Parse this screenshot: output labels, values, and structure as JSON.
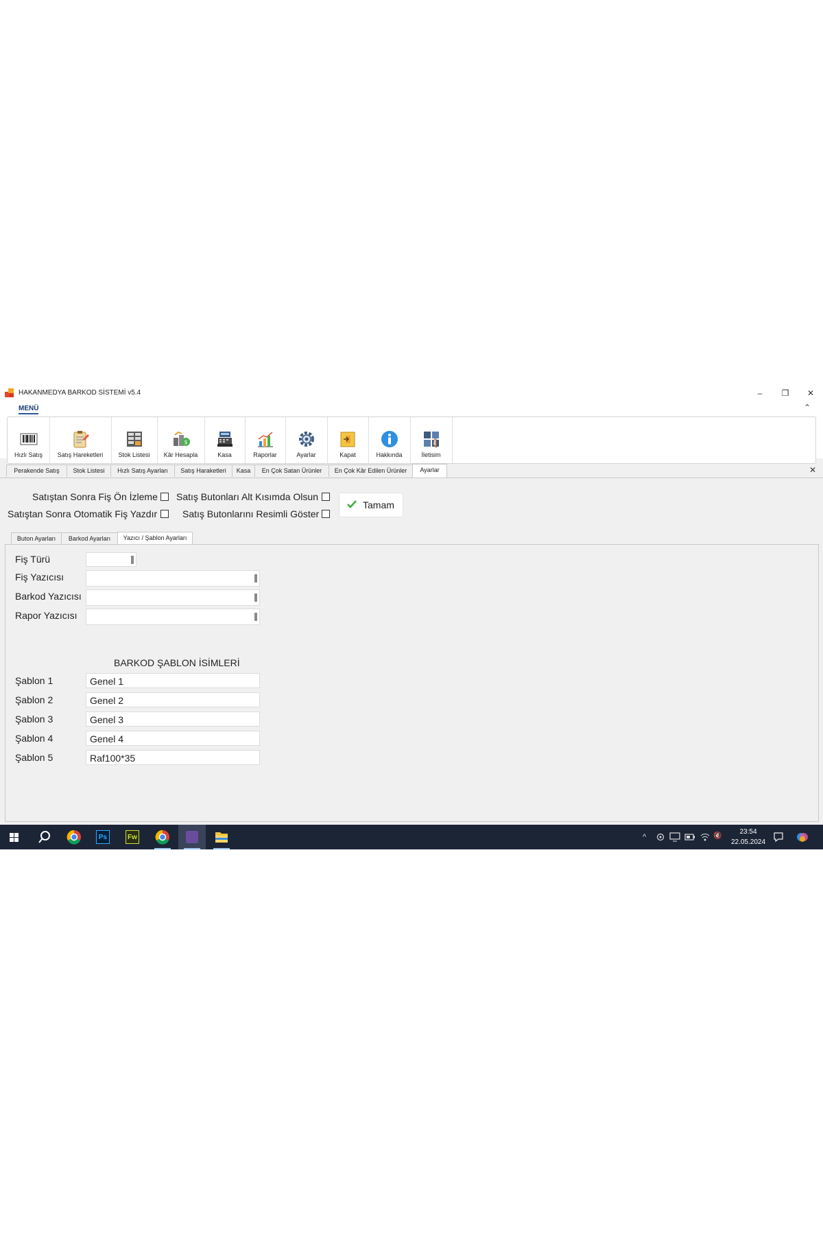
{
  "window": {
    "title": "HAKANMEDYA BARKOD SİSTEMİ v5.4",
    "controls": {
      "minimize": "–",
      "maximize": "❐",
      "close": "✕"
    }
  },
  "ribbon": {
    "menu_tab": "MENÜ",
    "collapse": "⌃",
    "buttons": [
      {
        "label": "Hızlı Satış",
        "icon": "barcode-icon"
      },
      {
        "label": "Satış Hareketleri",
        "icon": "clipboard-icon"
      },
      {
        "label": "Stok Listesi",
        "icon": "stock-list-icon"
      },
      {
        "label": "Kâr Hesapla",
        "icon": "profit-money-icon"
      },
      {
        "label": "Kasa",
        "icon": "cash-register-icon"
      },
      {
        "label": "Raporlar",
        "icon": "chart-icon"
      },
      {
        "label": "Ayarlar",
        "icon": "gear-icon"
      },
      {
        "label": "Kapat",
        "icon": "exit-door-icon"
      },
      {
        "label": "Hakkında",
        "icon": "info-icon"
      },
      {
        "label": "İletisim",
        "icon": "contact-icon"
      }
    ]
  },
  "doc_tabs": {
    "items": [
      "Perakende Satış",
      "Stok Listesi",
      "Hızlı Satış Ayarları",
      "Satış Haraketleri",
      "Kasa",
      "En Çok Satan Ürünler",
      "En Çok Kâr Edilen Ürünler",
      "Ayarlar"
    ],
    "active": "Ayarlar",
    "close": "✕"
  },
  "options": {
    "preview_after_sale": {
      "label": "Satıştan Sonra Fiş Ön İzleme",
      "checked": false
    },
    "auto_print_after_sale": {
      "label": "Satıştan Sonra Otomatik Fiş Yazdır",
      "checked": false
    },
    "sale_buttons_bottom": {
      "label": "Satış Butonları Alt Kısımda Olsun",
      "checked": false
    },
    "sale_buttons_images": {
      "label": "Satış Butonlarını Resimli Göster",
      "checked": false
    },
    "ok_button": "Tamam"
  },
  "inner_tabs": {
    "items": [
      "Buton Ayarları",
      "Barkod Ayarları",
      "Yazıcı / Şablon Ayarları"
    ],
    "active": "Yazıcı / Şablon Ayarları"
  },
  "printer_settings": {
    "fis_turu": {
      "label": "Fiş Türü",
      "value": ""
    },
    "fis_yazicisi": {
      "label": "Fiş Yazıcısı",
      "value": ""
    },
    "barkod_yazicisi": {
      "label": "Barkod Yazıcısı",
      "value": ""
    },
    "rapor_yazicisi": {
      "label": "Rapor Yazıcısı",
      "value": ""
    }
  },
  "templates": {
    "title": "BARKOD ŞABLON İSİMLERİ",
    "items": [
      {
        "label": "Şablon 1",
        "value": "Genel 1"
      },
      {
        "label": "Şablon 2",
        "value": "Genel 2"
      },
      {
        "label": "Şablon 3",
        "value": "Genel 3"
      },
      {
        "label": "Şablon 4",
        "value": "Genel 4"
      },
      {
        "label": "Şablon 5",
        "value": "Raf100*35"
      }
    ]
  },
  "taskbar": {
    "apps": [
      "start-icon",
      "search-icon",
      "chrome-icon",
      "photoshop-icon",
      "fireworks-icon",
      "chrome-icon",
      "visual-studio-icon",
      "file-explorer-icon"
    ],
    "photoshop_label": "Ps",
    "fireworks_label": "Fw",
    "tray": {
      "chevron": "^",
      "mute": "🔇"
    },
    "time": "23:54",
    "date": "22.05.2024",
    "colors": {
      "taskbar": "#1c2536",
      "accent": "#2b579a"
    }
  }
}
